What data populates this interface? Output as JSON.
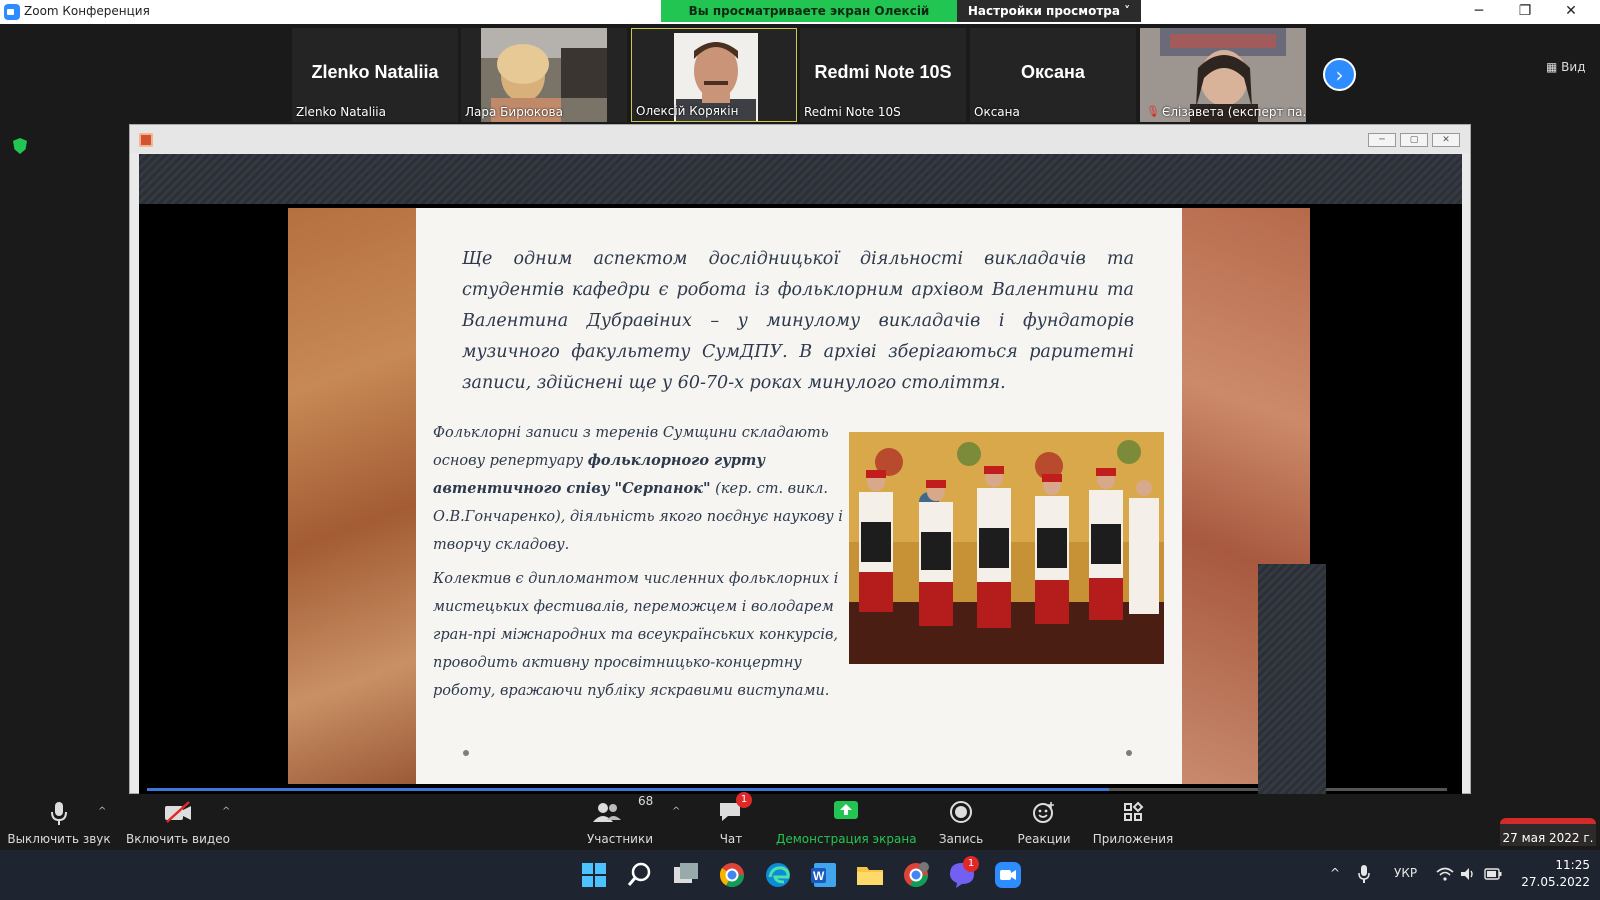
{
  "window": {
    "title": "Zoom Конференция",
    "share_banner": "Вы просматриваете экран Олексій Корякін",
    "view_options": "Настройки просмотра",
    "minimize": "─",
    "restore": "❐",
    "close": "✕"
  },
  "participants": [
    {
      "display": "Zlenko Nataliia",
      "label": "Zlenko Nataliia",
      "video": false
    },
    {
      "display": "",
      "label": "Лара Бирюкова",
      "video": true
    },
    {
      "display": "",
      "label": "Олексій Корякін",
      "video": true,
      "active": true
    },
    {
      "display": "Redmi Note 10S",
      "label": "Redmi Note 10S",
      "video": false
    },
    {
      "display": "Оксана",
      "label": "Оксана",
      "video": false
    },
    {
      "display": "",
      "label": "Єлізавета (експерт па...",
      "video": true,
      "muted": true
    }
  ],
  "view_button": "Вид",
  "slide": {
    "intro": "Ще одним аспектом дослідницької діяльності викладачів та студентів кафедри є робота із фольклорним архівом Валентини та Валентина Дубравіних – у минулому викладачів і фундаторів музичного факультету СумДПУ. В архіві зберігаються раритетні записи, здійснені ще у 60-70-х роках минулого століття.",
    "p1_start": "Фольклорні записи з теренів Сумщини складають основу репертуару ",
    "p1_bold": "фольклорного гурту автентичного співу \"Серпанок\"",
    "p1_end": " (кер. ст. викл. О.В.Гончаренко), діяльність якого поєднує наукову і творчу складову.",
    "p2": "Колектив є дипломантом численних фольклорних і мистецьких фестивалів, переможцем і володарем гран-прі міжнародних та всеукраїнських конкурсів, проводить активну просвітницько-концертну роботу, вражаючи публіку яскравими виступами."
  },
  "toolbar": {
    "mute": "Выключить звук",
    "video": "Включить видео",
    "participants": "Участники",
    "participants_count": "68",
    "chat": "Чат",
    "chat_badge": "1",
    "share": "Демонстрация экрана",
    "record": "Запись",
    "reactions": "Реакции",
    "apps": "Приложения"
  },
  "date_pill": "27 мая 2022 г.",
  "taskbar": {
    "lang": "УКР",
    "time": "11:25",
    "date": "27.05.2022",
    "viber_badge": "1"
  },
  "colors": {
    "accent": "#2d8cff",
    "share_green": "#23c552",
    "alert_red": "#e02828"
  },
  "progress": 0.74
}
